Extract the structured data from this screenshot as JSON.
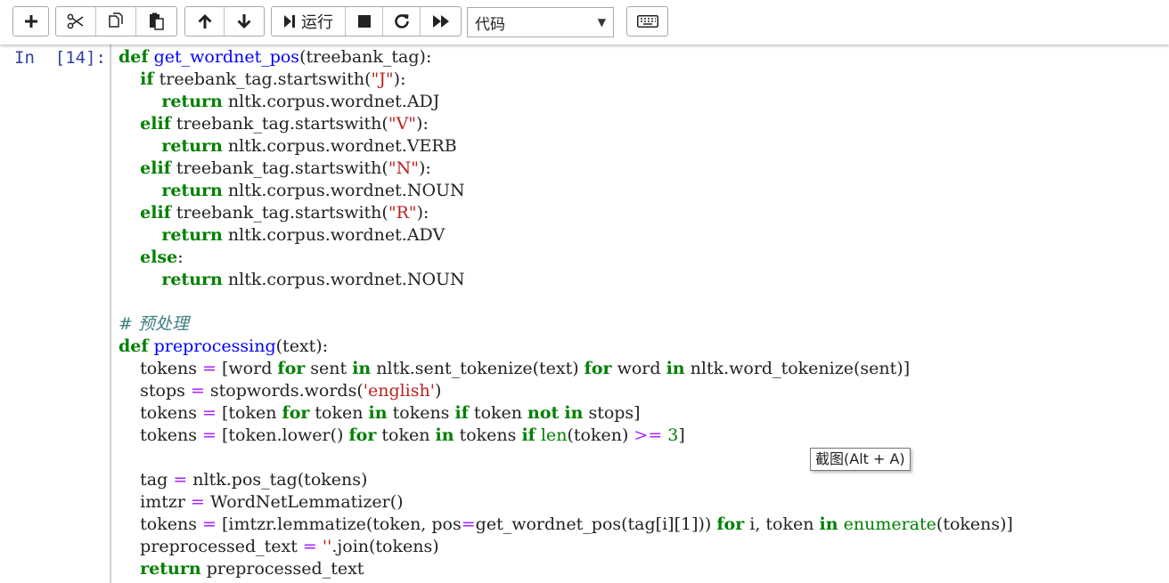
{
  "toolbar": {
    "run_label": "运行",
    "cell_type": "代码",
    "buttons": [
      "insert-cell",
      "cut",
      "copy",
      "paste",
      "move-up",
      "move-down",
      "run",
      "interrupt",
      "restart",
      "restart-run-all",
      "keyboard-shortcuts"
    ]
  },
  "cell": {
    "prompt": "In  [14]:",
    "lines": [
      [
        [
          "kw",
          "def"
        ],
        [
          "t",
          " "
        ],
        [
          "fn",
          "get_wordnet_pos"
        ],
        [
          "t",
          "(treebank_tag):"
        ]
      ],
      [
        [
          "t",
          "    "
        ],
        [
          "kw",
          "if"
        ],
        [
          "t",
          " treebank_tag.startswith("
        ],
        [
          "st",
          "\"J\""
        ],
        [
          "t",
          "):"
        ]
      ],
      [
        [
          "t",
          "        "
        ],
        [
          "kw",
          "return"
        ],
        [
          "t",
          " nltk.corpus.wordnet.ADJ"
        ]
      ],
      [
        [
          "t",
          "    "
        ],
        [
          "kw",
          "elif"
        ],
        [
          "t",
          " treebank_tag.startswith("
        ],
        [
          "st",
          "\"V\""
        ],
        [
          "t",
          "):"
        ]
      ],
      [
        [
          "t",
          "        "
        ],
        [
          "kw",
          "return"
        ],
        [
          "t",
          " nltk.corpus.wordnet.VERB"
        ]
      ],
      [
        [
          "t",
          "    "
        ],
        [
          "kw",
          "elif"
        ],
        [
          "t",
          " treebank_tag.startswith("
        ],
        [
          "st",
          "\"N\""
        ],
        [
          "t",
          "):"
        ]
      ],
      [
        [
          "t",
          "        "
        ],
        [
          "kw",
          "return"
        ],
        [
          "t",
          " nltk.corpus.wordnet.NOUN"
        ]
      ],
      [
        [
          "t",
          "    "
        ],
        [
          "kw",
          "elif"
        ],
        [
          "t",
          " treebank_tag.startswith("
        ],
        [
          "st",
          "\"R\""
        ],
        [
          "t",
          "):"
        ]
      ],
      [
        [
          "t",
          "        "
        ],
        [
          "kw",
          "return"
        ],
        [
          "t",
          " nltk.corpus.wordnet.ADV"
        ]
      ],
      [
        [
          "t",
          "    "
        ],
        [
          "kw",
          "else"
        ],
        [
          "t",
          ":"
        ]
      ],
      [
        [
          "t",
          "        "
        ],
        [
          "kw",
          "return"
        ],
        [
          "t",
          " nltk.corpus.wordnet.NOUN"
        ]
      ],
      [],
      [
        [
          "cm",
          "# 预处理"
        ]
      ],
      [
        [
          "kw",
          "def"
        ],
        [
          "t",
          " "
        ],
        [
          "fn",
          "preprocessing"
        ],
        [
          "t",
          "(text):"
        ]
      ],
      [
        [
          "t",
          "    tokens "
        ],
        [
          "op",
          "="
        ],
        [
          "t",
          " [word "
        ],
        [
          "kw",
          "for"
        ],
        [
          "t",
          " sent "
        ],
        [
          "kw",
          "in"
        ],
        [
          "t",
          " nltk.sent_tokenize(text) "
        ],
        [
          "kw",
          "for"
        ],
        [
          "t",
          " word "
        ],
        [
          "kw",
          "in"
        ],
        [
          "t",
          " nltk.word_tokenize(sent)]"
        ]
      ],
      [
        [
          "t",
          "    stops "
        ],
        [
          "op",
          "="
        ],
        [
          "t",
          " stopwords.words("
        ],
        [
          "st",
          "'english'"
        ],
        [
          "t",
          ")"
        ]
      ],
      [
        [
          "t",
          "    tokens "
        ],
        [
          "op",
          "="
        ],
        [
          "t",
          " [token "
        ],
        [
          "kw",
          "for"
        ],
        [
          "t",
          " token "
        ],
        [
          "kw",
          "in"
        ],
        [
          "t",
          " tokens "
        ],
        [
          "kw",
          "if"
        ],
        [
          "t",
          " token "
        ],
        [
          "kw",
          "not"
        ],
        [
          "t",
          " "
        ],
        [
          "kw",
          "in"
        ],
        [
          "t",
          " stops]"
        ]
      ],
      [
        [
          "t",
          "    tokens "
        ],
        [
          "op",
          "="
        ],
        [
          "t",
          " [token.lower() "
        ],
        [
          "kw",
          "for"
        ],
        [
          "t",
          " token "
        ],
        [
          "kw",
          "in"
        ],
        [
          "t",
          " tokens "
        ],
        [
          "kw",
          "if"
        ],
        [
          "t",
          " "
        ],
        [
          "bi",
          "len"
        ],
        [
          "t",
          "(token) "
        ],
        [
          "op",
          ">="
        ],
        [
          "t",
          " "
        ],
        [
          "nm",
          "3"
        ],
        [
          "t",
          "]"
        ]
      ],
      [],
      [
        [
          "t",
          "    tag "
        ],
        [
          "op",
          "="
        ],
        [
          "t",
          " nltk.pos_tag(tokens)"
        ]
      ],
      [
        [
          "t",
          "    imtzr "
        ],
        [
          "op",
          "="
        ],
        [
          "t",
          " WordNetLemmatizer()"
        ]
      ],
      [
        [
          "t",
          "    tokens "
        ],
        [
          "op",
          "="
        ],
        [
          "t",
          " [imtzr.lemmatize(token, pos"
        ],
        [
          "op",
          "="
        ],
        [
          "t",
          "get_wordnet_pos(tag[i][1])) "
        ],
        [
          "kw",
          "for"
        ],
        [
          "t",
          " i, token "
        ],
        [
          "kw",
          "in"
        ],
        [
          "t",
          " "
        ],
        [
          "bi",
          "enumerate"
        ],
        [
          "t",
          "(tokens)]"
        ]
      ],
      [
        [
          "t",
          "    preprocessed_text "
        ],
        [
          "op",
          "="
        ],
        [
          "t",
          " "
        ],
        [
          "st",
          "''"
        ],
        [
          "t",
          ".join(tokens)"
        ]
      ],
      [
        [
          "t",
          "    "
        ],
        [
          "kw",
          "return"
        ],
        [
          "t",
          " preprocessed_text"
        ]
      ]
    ]
  },
  "tooltip": {
    "text": "截图(Alt + A)"
  }
}
